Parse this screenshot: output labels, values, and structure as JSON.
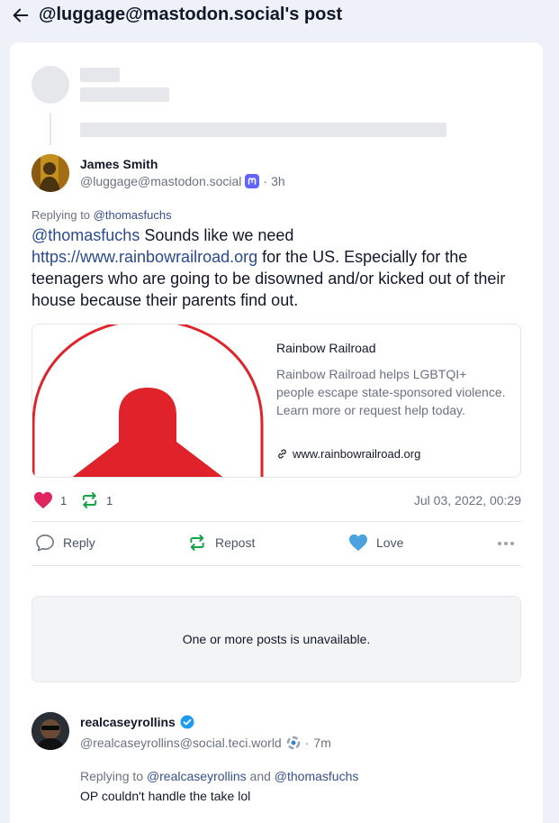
{
  "header": {
    "title": "@luggage@mastodon.social's post"
  },
  "post": {
    "display_name": "James Smith",
    "account": "@luggage@mastodon.social",
    "platform_icon": "mastodon-icon",
    "separator": "·",
    "time": "3h",
    "replying_prefix": "Replying to",
    "replying_to": "@thomasfuchs",
    "content": {
      "mention": "@thomasfuchs",
      "text1": " Sounds like we need ",
      "link": "https://www.rainbowrailroad.org",
      "text2": " for the US. Especially for the teenagers who are going to be disowned and/or kicked out of their house because their parents find out."
    },
    "link_card": {
      "title": "Rainbow Railroad",
      "description": "Rainbow Railroad helps LGBTQI+ people escape state-sponsored violence. Learn more or request help today.",
      "url": "www.rainbowrailroad.org"
    },
    "stats": {
      "likes": "1",
      "reposts": "1",
      "date": "Jul 03, 2022, 00:29"
    },
    "actions": {
      "reply": "Reply",
      "repost": "Repost",
      "love": "Love"
    }
  },
  "unavailable_notice": "One or more posts is unavailable.",
  "reply": {
    "display_name": "realcaseyrollins",
    "account": "@realcaseyrollins@social.teci.world",
    "separator": "·",
    "time": "7m",
    "replying_prefix": "Replying to",
    "replying_to_1": "@realcaseyrollins",
    "replying_and": "and",
    "replying_to_2": "@thomasfuchs",
    "text": "OP couldn't handle the take lol"
  },
  "colors": {
    "accent": "#2b4a8f",
    "like": "#e0245e",
    "repost": "#16a34a",
    "love": "#4aa3df",
    "mastodon": "#6364ff",
    "verified": "#1d9bf0",
    "rainbow_red": "#e0232b"
  }
}
